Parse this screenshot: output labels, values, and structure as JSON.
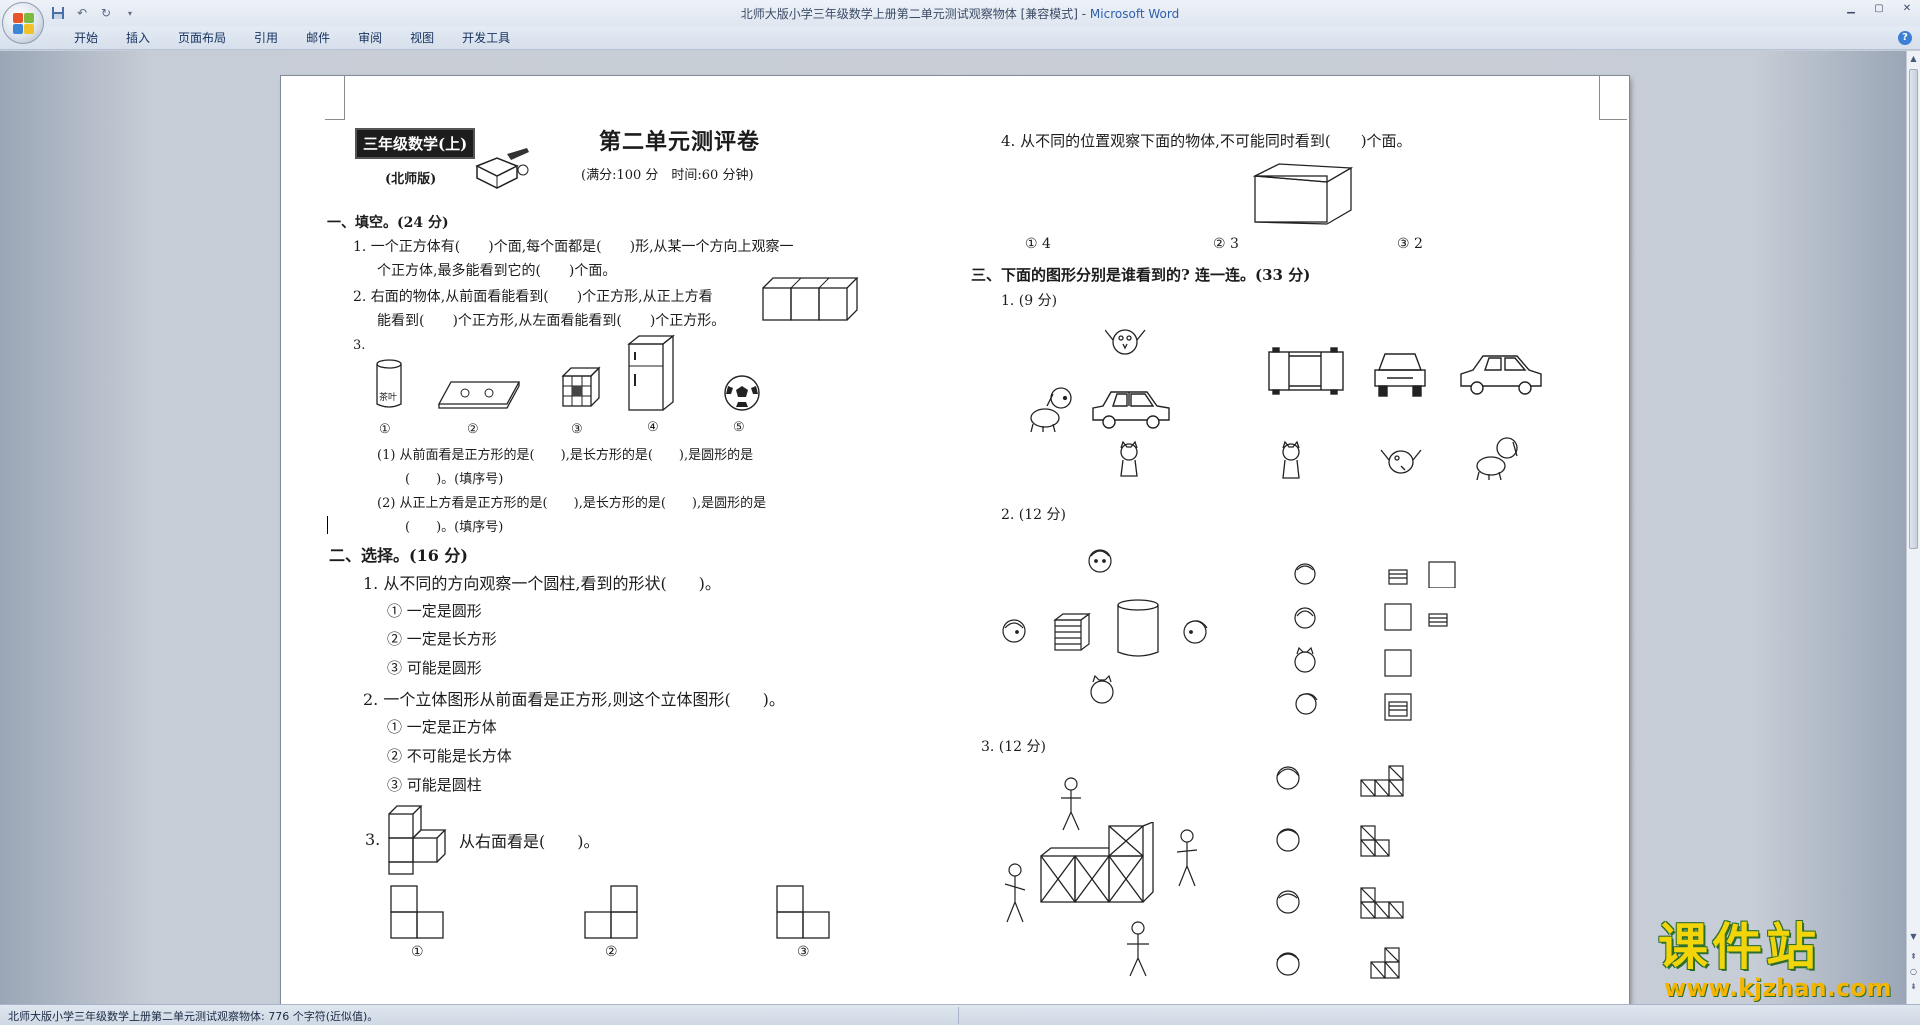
{
  "window": {
    "title": "北师大版小学三年级数学上册第二单元测试观察物体 [兼容模式] - ",
    "app_name": "Microsoft Word"
  },
  "quick_access": {
    "save_icon": "save-icon",
    "undo_icon": "undo-icon",
    "redo_icon": "redo-icon"
  },
  "ribbon_tabs": [
    "开始",
    "插入",
    "页面布局",
    "引用",
    "邮件",
    "审阅",
    "视图",
    "开发工具"
  ],
  "document": {
    "badge": "三年级数学(上)",
    "edition": "(北师版)",
    "title": "第二单元测评卷",
    "meta": "(满分:100 分　时间:60 分钟)",
    "s1_head": "一、填空。(24 分)",
    "s1_q1a": "1. 一个正方体有(　　)个面,每个面都是(　　)形,从某一个方向上观察一",
    "s1_q1b": "个正方体,最多能看到它的(　　)个面。",
    "s1_q2a": "2. 右面的物体,从前面看能看到(　　)个正方形,从正上方看",
    "s1_q2b": "能看到(　　)个正方形,从左面看能看到(　　)个正方形。",
    "s1_q3": "3.",
    "s1_q3_label": "茶叶",
    "s1_q3_nums": [
      "①",
      "②",
      "③",
      "④",
      "⑤"
    ],
    "s1_q3_1a": "(1) 从前面看是正方形的是(　　),是长方形的是(　　),是圆形的是",
    "s1_q3_1b": "(　　)。(填序号)",
    "s1_q3_2a": "(2) 从正上方看是正方形的是(　　),是长方形的是(　　),是圆形的是",
    "s1_q3_2b": "(　　)。(填序号)",
    "s2_head": "二、选择。(16 分)",
    "s2_q1": "1. 从不同的方向观察一个圆柱,看到的形状(　　)。",
    "s2_q1_opts": [
      "① 一定是圆形",
      "② 一定是长方形",
      "③ 可能是圆形"
    ],
    "s2_q2": "2. 一个立体图形从前面看是正方形,则这个立体图形(　　)。",
    "s2_q2_opts": [
      "① 一定是正方体",
      "② 不可能是长方体",
      "③ 可能是圆柱"
    ],
    "s2_q3_num": "3.",
    "s2_q3_text": "从右面看是(　　)。",
    "s2_q3_nums": [
      "①",
      "②",
      "③"
    ],
    "r_q4": "4. 从不同的位置观察下面的物体,不可能同时看到(　　)个面。",
    "r_q4_opts": [
      "① 4",
      "② 3",
      "③ 2"
    ],
    "s3_head": "三、下面的图形分别是谁看到的? 连一连。(33 分)",
    "s3_p1": "1. (9 分)",
    "s3_p2": "2. (12 分)",
    "s3_p3": "3. (12 分)"
  },
  "status_bar": {
    "text": "北师大版小学三年级数学上册第二单元测试观察物体: 776 个字符(近似值)。"
  },
  "watermark": {
    "cn": "课件站",
    "url": "www.kjzhan.com"
  }
}
